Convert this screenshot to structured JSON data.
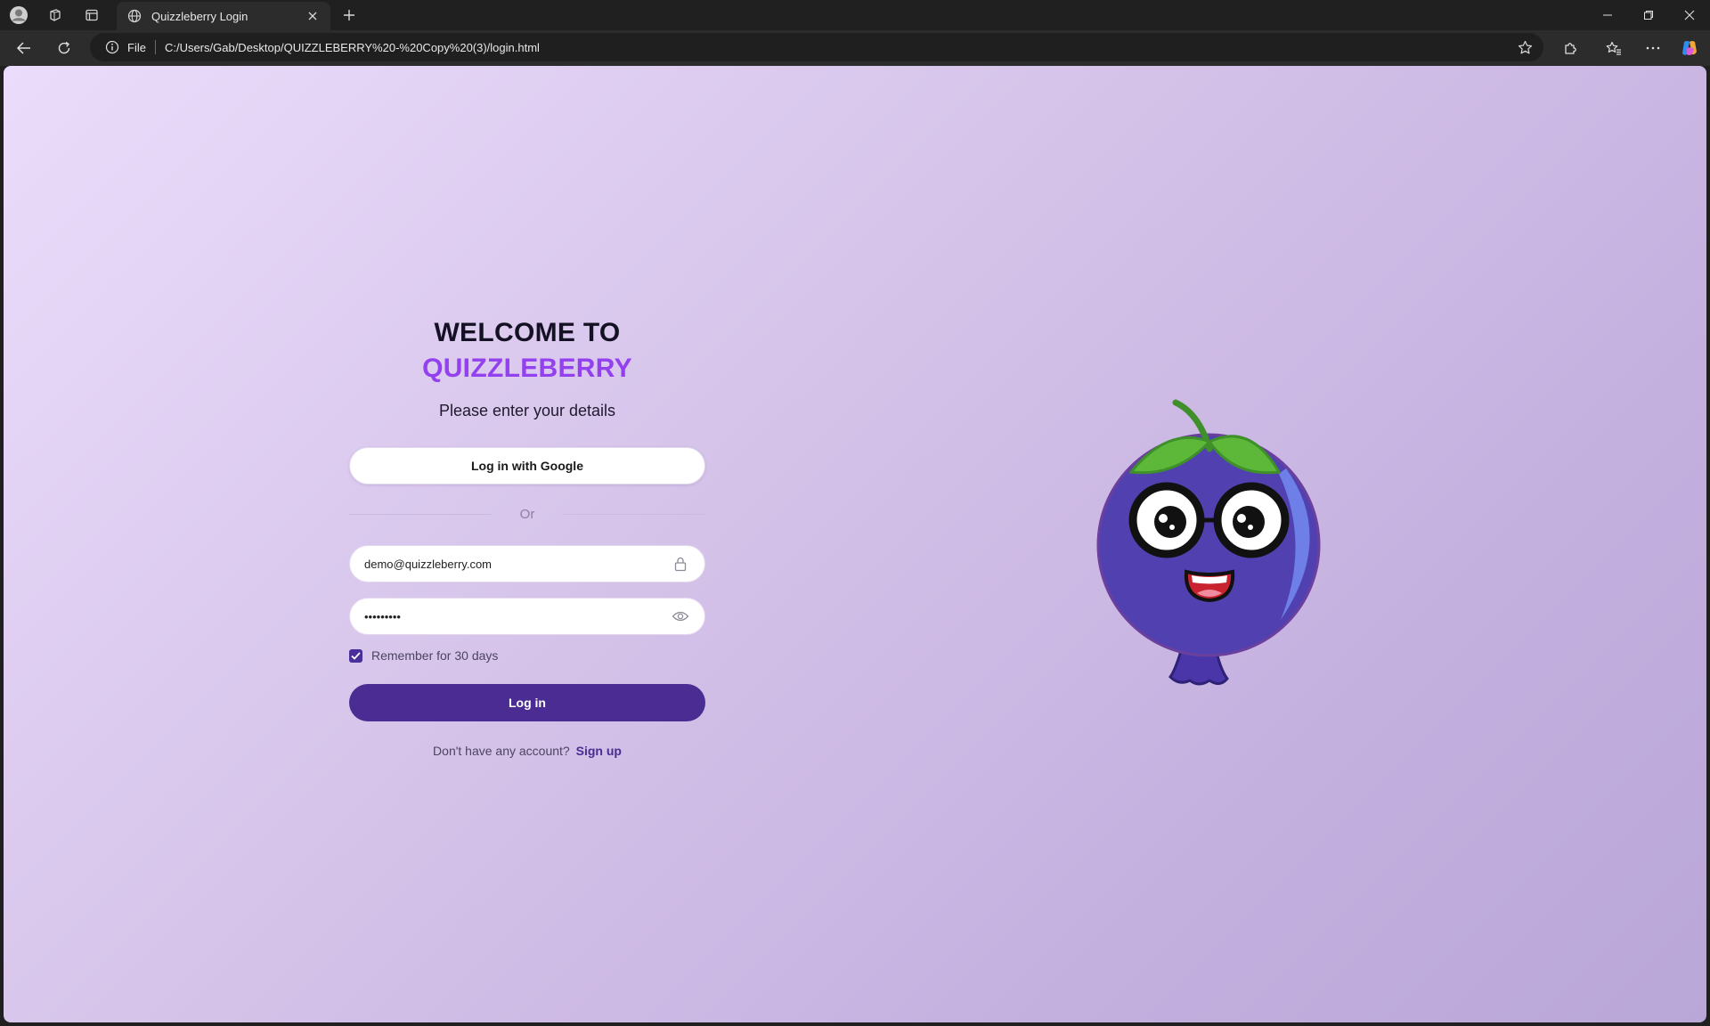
{
  "browser": {
    "tab_title": "Quizzleberry Login",
    "address_protocol": "File",
    "address_url": "C:/Users/Gab/Desktop/QUIZZLEBERRY%20-%20Copy%20(3)/login.html"
  },
  "page": {
    "welcome_line": "WELCOME TO",
    "brand_line": "QUIZZLEBERRY",
    "subtitle": "Please enter your details",
    "google_button": "Log in with Google",
    "divider_text": "Or",
    "email": {
      "value": "demo@quizzleberry.com"
    },
    "password": {
      "value": "demo1234!"
    },
    "remember_label": "Remember for 30 days",
    "remember_checked": true,
    "login_button": "Log in",
    "signup_prompt": "Don't have any account?",
    "signup_link": "Sign up"
  },
  "colors": {
    "brand_purple": "#9340ee",
    "primary_button": "#4a2c92",
    "background_start": "#ebdcfb",
    "background_end": "#b9a7d8"
  },
  "icons": {
    "tabbar": [
      "profile-avatar-icon",
      "workspaces-icon",
      "tab-actions-icon",
      "globe-icon",
      "close-icon",
      "new-tab-icon"
    ],
    "toolbar": [
      "back-arrow-icon",
      "refresh-icon",
      "info-icon",
      "star-icon",
      "extensions-icon",
      "favorites-icon",
      "more-icon",
      "copilot-icon"
    ],
    "fields": [
      "lock-icon",
      "eye-icon"
    ]
  }
}
